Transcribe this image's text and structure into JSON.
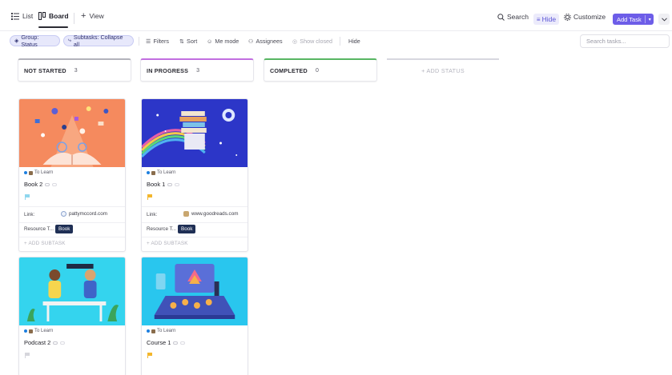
{
  "toolbar": {
    "tabs": [
      {
        "label": "List",
        "icon": "list-icon"
      },
      {
        "label": "Board",
        "icon": "board-icon"
      },
      {
        "label": "View",
        "icon": "plus-icon"
      }
    ],
    "search_label": "Search",
    "hide_label": "Hide",
    "customize_label": "Customize",
    "add_task_label": "Add Task"
  },
  "filters": {
    "group": "Group: Status",
    "subtasks": "Subtasks: Collapse all",
    "filters": "Filters",
    "sort": "Sort",
    "me_mode": "Me mode",
    "assignees": "Assignees",
    "show_closed": "Show closed",
    "hide": "Hide",
    "search_placeholder": "Search tasks..."
  },
  "columns": [
    {
      "title": "NOT STARTED",
      "count": "3",
      "color": "#b3b3bb"
    },
    {
      "title": "IN PROGRESS",
      "count": "3",
      "color": "#c26ee0"
    },
    {
      "title": "COMPLETED",
      "count": "0",
      "color": "#58b663"
    }
  ],
  "add_status_label": "+ ADD STATUS",
  "cards": [
    {
      "list": "To Learn",
      "title": "Book 2",
      "flag_color": "#8fd7ee",
      "link_label": "Link:",
      "link_value": "pattymccord.com",
      "field_label": "Resource T...",
      "badge": "Book",
      "add_subtask": "+ ADD SUBTASK"
    },
    {
      "list": "To Learn",
      "title": "Book 1",
      "flag_color": "#f3b62c",
      "link_label": "Link:",
      "link_value": "www.goodreads.com",
      "field_label": "Resource T...",
      "badge": "Book",
      "add_subtask": "+ ADD SUBTASK"
    },
    {
      "list": "To Learn",
      "title": "Podcast 2",
      "flag_color": "#d6d6dc"
    },
    {
      "list": "To Learn",
      "title": "Course 1",
      "flag_color": "#f3b62c"
    }
  ],
  "colors": {
    "accent": "#6d5de8",
    "badge_bg": "#1f2f55"
  }
}
